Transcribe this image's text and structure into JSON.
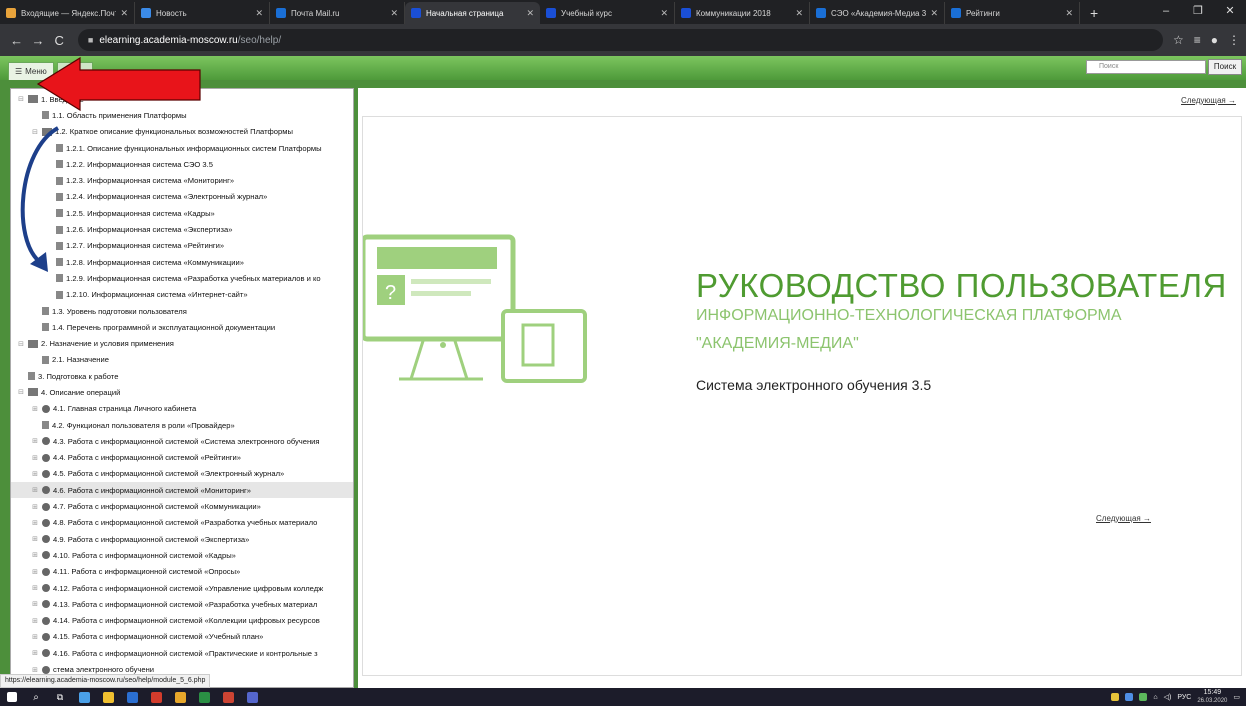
{
  "browser": {
    "tabs": [
      {
        "title": "Входящие — Яндекс.Почт",
        "color": "#e8a33b"
      },
      {
        "title": "Новость",
        "color": "#3b8be8"
      },
      {
        "title": "Почта Mail.ru",
        "color": "#1a6fd6"
      },
      {
        "title": "Начальная страница",
        "color": "#1a4fd6",
        "active": true
      },
      {
        "title": "Учебный курс",
        "color": "#1a4fd6"
      },
      {
        "title": "Коммуникации 2018",
        "color": "#1a4fd6"
      },
      {
        "title": "СЭО «Академия-Медиа 3.",
        "color": "#1a6fd6"
      },
      {
        "title": "Рейтинги",
        "color": "#1a6fd6"
      }
    ],
    "newtab": "+",
    "url_host": "elearning.academia-moscow.ru",
    "url_path": "/seo/help/",
    "status_url": "https://elearning.academia-moscow.ru/seo/help/module_5_6.php"
  },
  "app": {
    "tab_menu": "Меню",
    "tab_search": "Пои",
    "search_placeholder": "Поиск",
    "search_button": "Поиск"
  },
  "sidebar": {
    "items": [
      {
        "label": "1. Введение",
        "level": 0,
        "icon": "book",
        "toggle": "⊟"
      },
      {
        "label": "1.1. Область применения Платформы",
        "level": 1,
        "icon": "doc"
      },
      {
        "label": "1.2. Краткое описание функциональных возможностей Платформы",
        "level": 1,
        "icon": "book",
        "toggle": "⊟"
      },
      {
        "label": "1.2.1. Описание функциональных информационных систем Платформы",
        "level": 2,
        "icon": "doc"
      },
      {
        "label": "1.2.2. Информационная система СЭО 3.5",
        "level": 2,
        "icon": "doc"
      },
      {
        "label": "1.2.3. Информационная система «Мониторинг»",
        "level": 2,
        "icon": "doc"
      },
      {
        "label": "1.2.4. Информационная система «Электронный журнал»",
        "level": 2,
        "icon": "doc"
      },
      {
        "label": "1.2.5. Информационная система «Кадры»",
        "level": 2,
        "icon": "doc"
      },
      {
        "label": "1.2.6. Информационная система «Экспертиза»",
        "level": 2,
        "icon": "doc"
      },
      {
        "label": "1.2.7. Информационная система «Рейтинги»",
        "level": 2,
        "icon": "doc"
      },
      {
        "label": "1.2.8. Информационная система «Коммуникации»",
        "level": 2,
        "icon": "doc"
      },
      {
        "label": "1.2.9. Информационная система «Разработка учебных материалов и ко",
        "level": 2,
        "icon": "doc"
      },
      {
        "label": "1.2.10. Информационная система «Интернет-сайт»",
        "level": 2,
        "icon": "doc"
      },
      {
        "label": "1.3. Уровень подготовки пользователя",
        "level": 1,
        "icon": "doc"
      },
      {
        "label": "1.4. Перечень программной и эксплуатационной документации",
        "level": 1,
        "icon": "doc"
      },
      {
        "label": "2. Назначение и условия применения",
        "level": 0,
        "icon": "book",
        "toggle": "⊟"
      },
      {
        "label": "2.1. Назначение",
        "level": 1,
        "icon": "doc"
      },
      {
        "label": "3. Подготовка к работе",
        "level": 0,
        "icon": "doc"
      },
      {
        "label": "4. Описание операций",
        "level": 0,
        "icon": "book",
        "toggle": "⊟"
      },
      {
        "label": "4.1. Главная страница Личного кабинета",
        "level": 1,
        "icon": "gear",
        "toggle": "⊞"
      },
      {
        "label": "4.2. Функционал пользователя в роли «Провайдер»",
        "level": 1,
        "icon": "doc"
      },
      {
        "label": "4.3. Работа с информационной системой «Система электронного обучения",
        "level": 1,
        "icon": "gear",
        "toggle": "⊞"
      },
      {
        "label": "4.4. Работа с информационной системой «Рейтинги»",
        "level": 1,
        "icon": "gear",
        "toggle": "⊞"
      },
      {
        "label": "4.5. Работа с информационной системой «Электронный журнал»",
        "level": 1,
        "icon": "gear",
        "toggle": "⊞"
      },
      {
        "label": "4.6. Работа с информационной системой «Мониторинг»",
        "level": 1,
        "icon": "gear",
        "toggle": "⊞",
        "highlight": true
      },
      {
        "label": "4.7. Работа с информационной системой «Коммуникации»",
        "level": 1,
        "icon": "gear",
        "toggle": "⊞"
      },
      {
        "label": "4.8. Работа с информационной системой «Разработка учебных материало",
        "level": 1,
        "icon": "gear",
        "toggle": "⊞"
      },
      {
        "label": "4.9. Работа с информационной системой «Экспертиза»",
        "level": 1,
        "icon": "gear",
        "toggle": "⊞"
      },
      {
        "label": "4.10. Работа с информационной системой «Кадры»",
        "level": 1,
        "icon": "gear",
        "toggle": "⊞"
      },
      {
        "label": "4.11. Работа с информационной системой «Опросы»",
        "level": 1,
        "icon": "gear",
        "toggle": "⊞"
      },
      {
        "label": "4.12. Работа с информационной системой «Управление цифровым колледж",
        "level": 1,
        "icon": "gear",
        "toggle": "⊞"
      },
      {
        "label": "4.13. Работа с информационной системой «Разработка учебных материал",
        "level": 1,
        "icon": "gear",
        "toggle": "⊞"
      },
      {
        "label": "4.14. Работа с информационной системой «Коллекции цифровых ресурсов",
        "level": 1,
        "icon": "gear",
        "toggle": "⊞"
      },
      {
        "label": "4.15. Работа с информационной системой «Учебный план»",
        "level": 1,
        "icon": "gear",
        "toggle": "⊞"
      },
      {
        "label": "4.16. Работа с информационной системой «Практические и контрольные з",
        "level": 1,
        "icon": "gear",
        "toggle": "⊞"
      },
      {
        "label": "стема электронного обучени",
        "level": 1,
        "icon": "gear",
        "toggle": "⊞"
      }
    ]
  },
  "main": {
    "next_top": "Следующая →",
    "next_bottom": "Следующая →",
    "title": "РУКОВОДСТВО ПОЛЬЗОВАТЕЛЯ",
    "subtitle_line1": "ИНФОРМАЦИОННО-ТЕХНОЛОГИЧЕСКАЯ ПЛАТФОРМА",
    "subtitle_line2": "\"АКАДЕМИЯ-МЕДИА\"",
    "system": "Система электронного обучения 3.5",
    "illus_mark": "?"
  },
  "taskbar": {
    "lang": "РУС",
    "time": "15:49",
    "date": "26.03.2020",
    "app_colors": [
      "#4aa0e8",
      "#f0c030",
      "#2b6fd1",
      "#d23c2c",
      "#e8a82b",
      "#2a8f44",
      "#c43",
      "#56c"
    ]
  },
  "colors": {
    "accent_green": "#4f9b31",
    "annotation_red": "#e8141a",
    "annotation_blue": "#1d3f8a"
  }
}
